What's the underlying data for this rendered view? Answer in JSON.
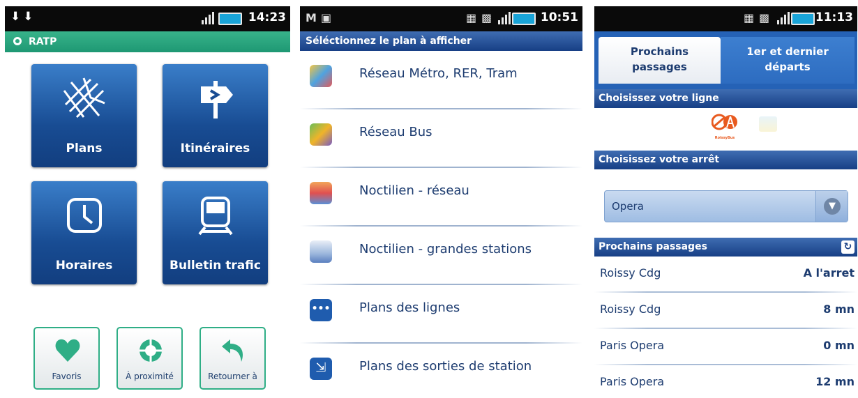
{
  "screen1": {
    "status_time": "14:23",
    "app_name": "RATP",
    "tiles": [
      {
        "label": "Plans",
        "icon": "map-icon"
      },
      {
        "label": "Itinéraires",
        "icon": "signpost-icon"
      },
      {
        "label": "Horaires",
        "icon": "clock-icon"
      },
      {
        "label": "Bulletin trafic",
        "icon": "train-icon"
      }
    ],
    "shortcuts": [
      {
        "label": "Favoris",
        "icon": "heart-icon"
      },
      {
        "label": "À proximité",
        "icon": "target-icon"
      },
      {
        "label": "Retourner à",
        "icon": "return-arrow-icon"
      }
    ],
    "colors": {
      "accent": "#1e9873",
      "tile": "#184c93"
    }
  },
  "screen2": {
    "status_time": "10:51",
    "title": "Séléctionnez le plan à afficher",
    "items": [
      {
        "label": "Réseau Métro, RER, Tram",
        "icon": "metro-map-icon"
      },
      {
        "label": "Réseau Bus",
        "icon": "bus-map-icon"
      },
      {
        "label": "Noctilien - réseau",
        "icon": "noctilien-network-icon"
      },
      {
        "label": "Noctilien - grandes stations",
        "icon": "noctilien-stations-icon"
      },
      {
        "label": "Plans des lignes",
        "icon": "line-plans-icon"
      },
      {
        "label": "Plans des sorties de station",
        "icon": "station-exit-icon"
      }
    ]
  },
  "screen3": {
    "status_time": "11:13",
    "tab_active_line1": "Prochains",
    "tab_active_line2": "passages",
    "tab_inactive_line1": "1er et dernier",
    "tab_inactive_line2": "départs",
    "section_line": "Choisissez votre ligne",
    "line_logo_text": "RoissyBus",
    "section_stop": "Choisissez votre arrêt",
    "selected_stop": "Opera",
    "section_next": "Prochains passages",
    "departures": [
      {
        "destination": "Roissy Cdg",
        "wait": "A l'arret"
      },
      {
        "destination": "Roissy Cdg",
        "wait": "8 mn"
      },
      {
        "destination": "Paris Opera",
        "wait": "0 mn"
      },
      {
        "destination": "Paris Opera",
        "wait": "12 mn"
      }
    ]
  }
}
